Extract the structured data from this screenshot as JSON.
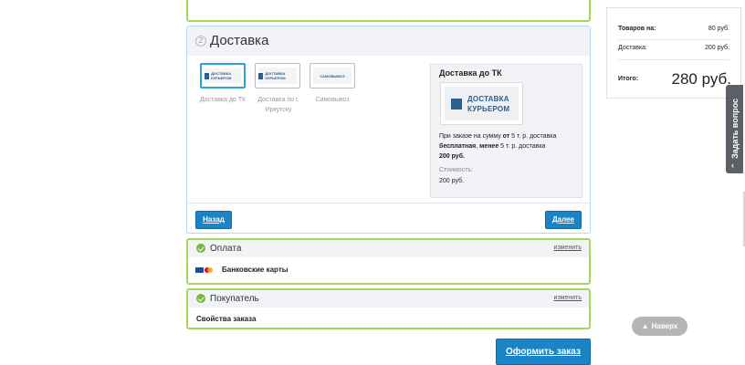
{
  "delivery": {
    "step": "2",
    "title": "Доставка",
    "options": [
      {
        "label": "Доставка до ТК",
        "logo_text": "ДОСТАВКА КУРЬЕРОМ",
        "selected": true
      },
      {
        "label": "Доставка по г. Иркутску",
        "logo_text": "ДОСТАВКА КУРЬЕРОМ",
        "selected": false
      },
      {
        "label": "Самовывоз",
        "logo_text": "САМОВЫВОЗ",
        "selected": false
      }
    ],
    "info": {
      "title": "Доставка до ТК",
      "logo_line1": "ДОСТАВКА",
      "logo_line2": "КУРЬЕРОМ",
      "desc_part1": "При заказе на сумму ",
      "desc_bold1": "от",
      "desc_part2": " 5 т. р. доставка ",
      "desc_bold2": "бесплатная",
      "desc_part3": ", ",
      "desc_bold3": "менее",
      "desc_part4": " 5 т. р. доставка ",
      "desc_bold4": "200 руб.",
      "cost_label": "Стоимость:",
      "cost_value": "200 руб."
    },
    "back_label": "Назад",
    "next_label": "Далее"
  },
  "payment": {
    "title": "Оплата",
    "change_label": "изменить",
    "method": "Банковские карты"
  },
  "buyer": {
    "title": "Покупатель",
    "change_label": "изменить",
    "props": "Свойства заказа"
  },
  "order_button": "Оформить заказ",
  "summary": {
    "goods_label": "Товаров на:",
    "goods_value": "80 руб.",
    "delivery_label": "Доставка:",
    "delivery_value": "200 руб.",
    "total_label": "Итого:",
    "total_value": "280 руб."
  },
  "ask_question": "Задать вопрос",
  "up_button": "Наверх",
  "colors": {
    "accent_blue": "#1a84c6",
    "complete_green": "#a6d65c",
    "check_green": "#74b83e"
  }
}
